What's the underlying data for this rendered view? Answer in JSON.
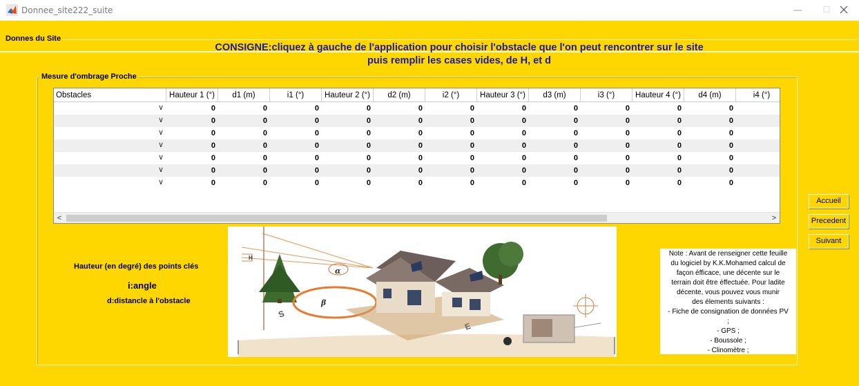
{
  "window": {
    "title": "Donnee_site222_suite",
    "minimize": "—",
    "maximize": "☐"
  },
  "panel_title": "Donnes du Site",
  "consigne": {
    "line1": "CONSIGNE:cliquez à gauche de l'application pour  choisir l'obstacle que l'on peut rencontrer sur le site",
    "line2": "puis remplir les cases vides, de H, et d"
  },
  "group_title": "Mesure d'ombrage Proche",
  "table": {
    "columns": [
      "Obstacles",
      "Hauteur 1 (°)",
      "d1 (m)",
      "i1 (°)",
      "Hauteur 2 (°)",
      "d2 (m)",
      "i2 (°)",
      "Hauteur 3 (°)",
      "d3 (m)",
      "i3 (°)",
      "Hauteur 4 (°)",
      "d4 (m)",
      "i4 (°)"
    ],
    "rows": [
      [
        "",
        "0",
        "0",
        "0",
        "0",
        "0",
        "0",
        "0",
        "0",
        "0",
        "0",
        "0",
        ""
      ],
      [
        "",
        "0",
        "0",
        "0",
        "0",
        "0",
        "0",
        "0",
        "0",
        "0",
        "0",
        "0",
        ""
      ],
      [
        "",
        "0",
        "0",
        "0",
        "0",
        "0",
        "0",
        "0",
        "0",
        "0",
        "0",
        "0",
        ""
      ],
      [
        "",
        "0",
        "0",
        "0",
        "0",
        "0",
        "0",
        "0",
        "0",
        "0",
        "0",
        "0",
        ""
      ],
      [
        "",
        "0",
        "0",
        "0",
        "0",
        "0",
        "0",
        "0",
        "0",
        "0",
        "0",
        "0",
        ""
      ],
      [
        "",
        "0",
        "0",
        "0",
        "0",
        "0",
        "0",
        "0",
        "0",
        "0",
        "0",
        "0",
        ""
      ],
      [
        "",
        "0",
        "0",
        "0",
        "0",
        "0",
        "0",
        "0",
        "0",
        "0",
        "0",
        "0",
        ""
      ]
    ],
    "scroll_left": "<",
    "scroll_right": ">"
  },
  "buttons": {
    "accueil": "Accueil",
    "precedent": "Precedent",
    "suivant": "Suivant"
  },
  "legend": {
    "hauteur": "Hauteur (en degré) des points clés",
    "angle": "i:angle",
    "distance": "d:distancle à l'obstacle"
  },
  "note": [
    "Note : Avant de renseigner cette feuille",
    "du logiciel  by K.K.Mohamed calcul de",
    "façon éfficace, une  décente sur le",
    "terrain doit être éffectuée. Pour ladite",
    "décente, vous pouvez vous  munir",
    "des élements suivants :",
    "- Fiche de consignation de données PV",
    ";",
    "- GPS ;",
    "- Boussole ;",
    "- Clinomètre ;"
  ],
  "illustration": {
    "labels": [
      "H",
      "α",
      "β",
      "S",
      "E"
    ]
  }
}
